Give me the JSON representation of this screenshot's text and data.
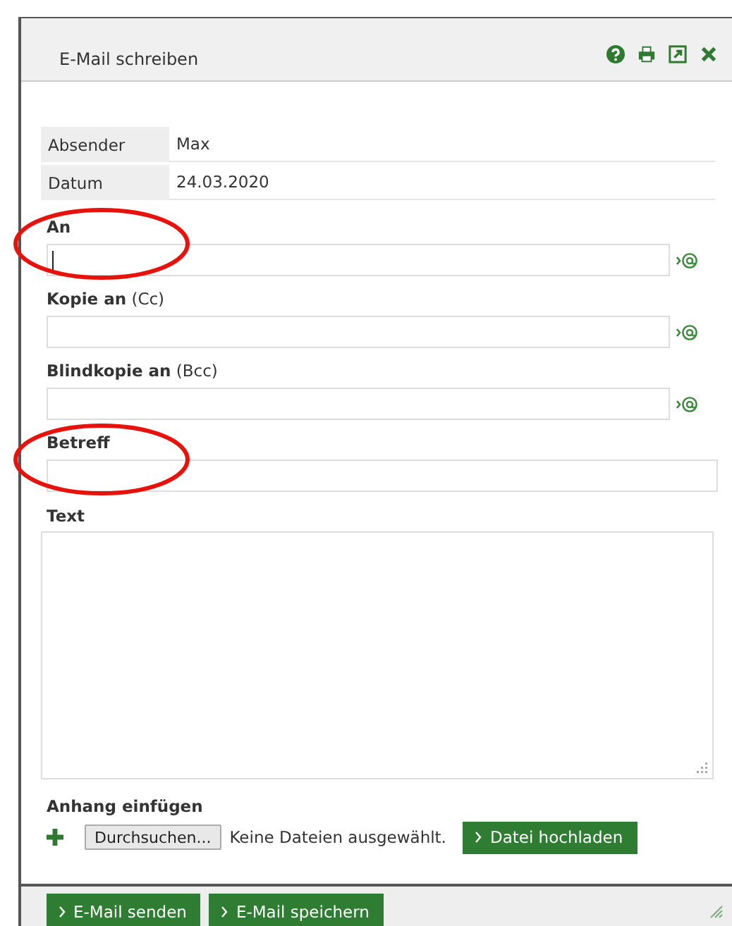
{
  "window": {
    "title": "E-Mail schreiben"
  },
  "info": [
    {
      "label": "Absender",
      "value": "Max"
    },
    {
      "label": "Datum",
      "value": "24.03.2020"
    }
  ],
  "fields": [
    {
      "kind": "recipient",
      "label": "An",
      "focused": true,
      "circled": true
    },
    {
      "kind": "recipient",
      "label": "Kopie an",
      "note": "(Cc)",
      "focused": false,
      "circled": false
    },
    {
      "kind": "recipient",
      "label": "Blindkopie an",
      "note": "(Bcc)",
      "focused": false,
      "circled": false
    },
    {
      "kind": "plain",
      "label": "Betreff",
      "focused": false,
      "circled": true
    },
    {
      "kind": "textarea",
      "label": "Text",
      "focused": false,
      "circled": false
    }
  ],
  "attachment": {
    "label": "Anhang einfügen",
    "browse_button": "Durchsuchen...",
    "status": "Keine Dateien ausgewählt.",
    "upload_button": "Datei hochladen"
  },
  "footer_buttons": [
    "E-Mail senden",
    "E-Mail speichern"
  ]
}
